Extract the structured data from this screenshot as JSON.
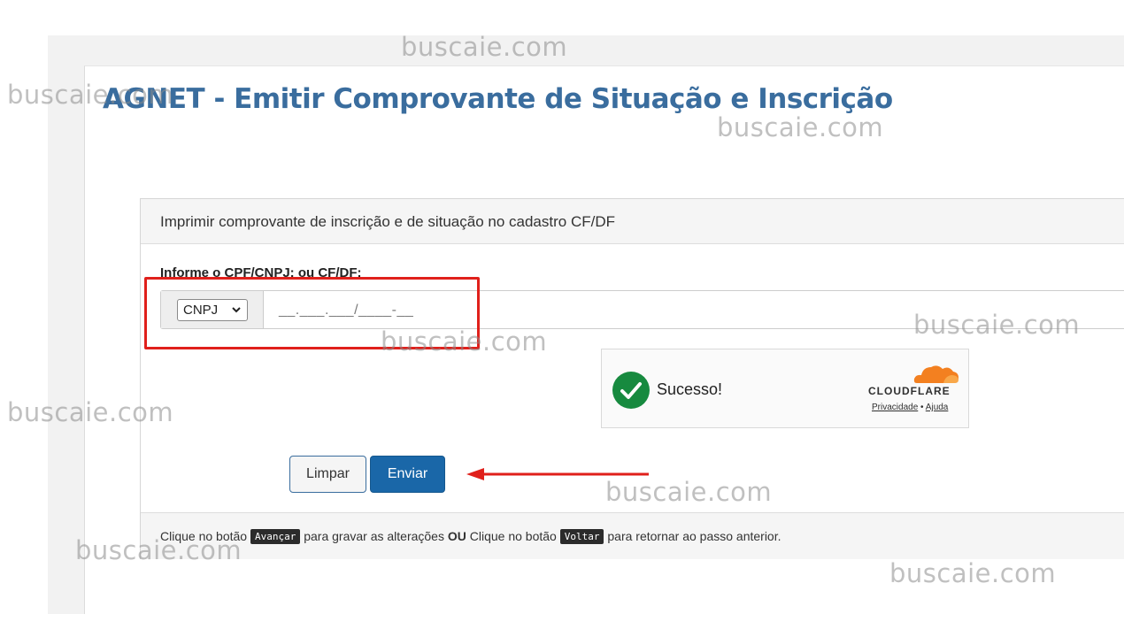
{
  "page": {
    "title": "AGNET - Emitir Comprovante de Situação e Inscrição"
  },
  "panel": {
    "header": "Imprimir comprovante de inscrição e de situação no cadastro CF/DF",
    "field_label": "Informe o CPF/CNPJ: ou CF/DF:",
    "document_type": {
      "selected": "CNPJ"
    },
    "document_input": {
      "placeholder": "__.___.___/____-__",
      "value": ""
    }
  },
  "captcha": {
    "status": "Sucesso!",
    "brand": "CLOUDFLARE",
    "links": [
      "Privacidade",
      "Ajuda"
    ],
    "separator": "•",
    "check_color": "#178a3f",
    "brand_color": "#f38020"
  },
  "buttons": {
    "clear_label": "Limpar",
    "send_label": "Enviar"
  },
  "footer": {
    "text_1": "Clique no botão",
    "key_1": "Avançar",
    "text_2": "para gravar as alterações",
    "bold": "OU",
    "text_3": "Clique no botão",
    "key_2": "Voltar",
    "text_4": "para retornar ao passo anterior."
  },
  "watermark": {
    "text": "buscaie.com"
  },
  "annotations": {
    "highlight_color": "#e0201b"
  }
}
